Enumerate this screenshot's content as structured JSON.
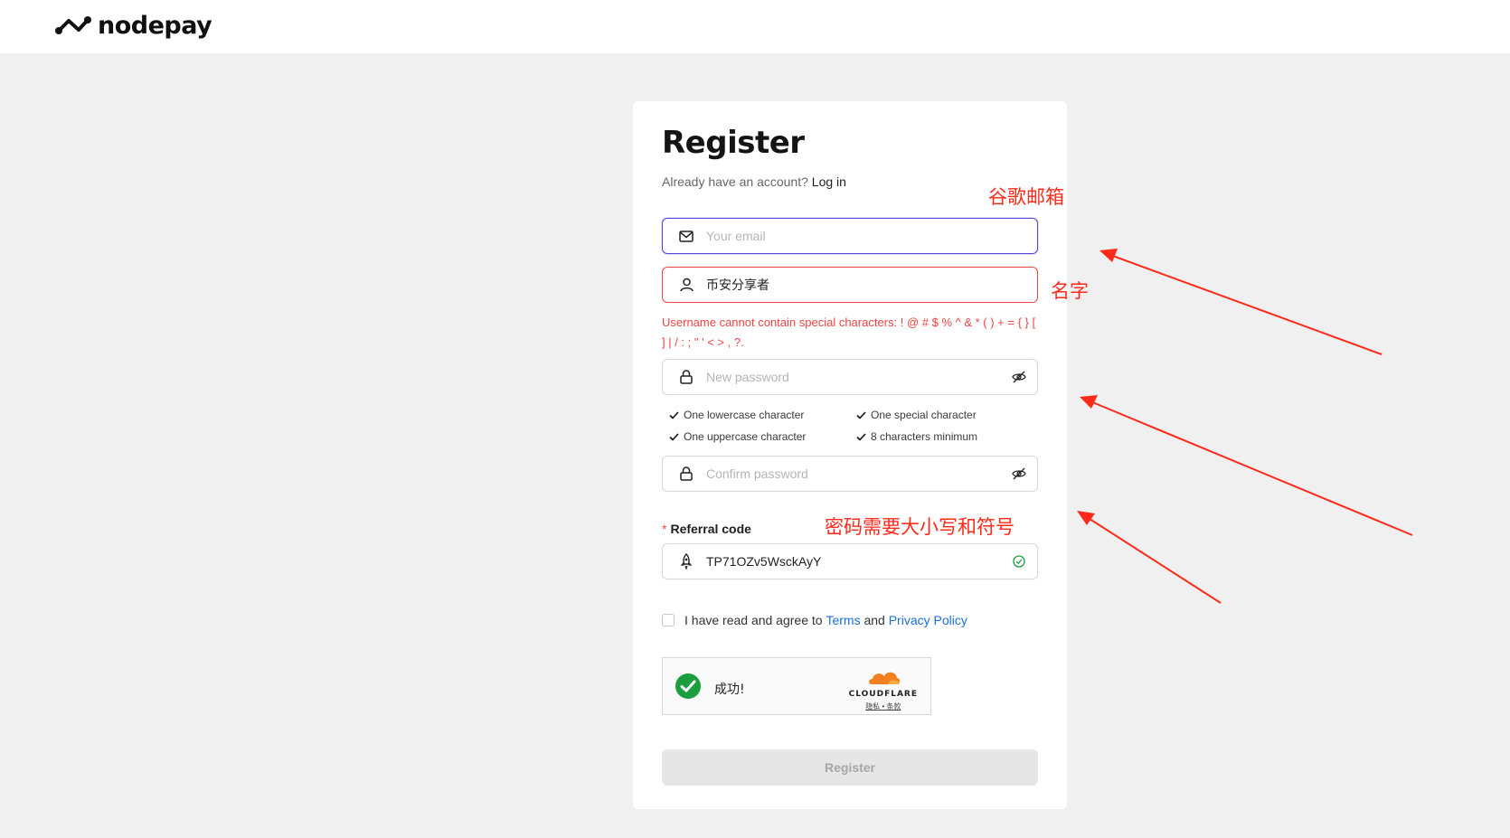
{
  "brand": {
    "name": "nodepay"
  },
  "form": {
    "title": "Register",
    "have_account": "Already have an account?",
    "login_link": "Log in",
    "email_placeholder": "Your email",
    "username_value": "币安分享者",
    "username_error": "Username cannot contain special characters: ! @ # $ % ^ & * ( ) + = { } [ ] | / : ; \" ' < > , ?.",
    "password_placeholder": "New password",
    "requirements": [
      "One lowercase character",
      "One special character",
      "One uppercase character",
      "8 characters minimum"
    ],
    "confirm_placeholder": "Confirm password",
    "referral_label": "Referral code",
    "referral_value": "TP71OZv5WsckAyY",
    "terms_prefix": "I have read and agree to",
    "terms_link": "Terms",
    "terms_and": "and",
    "privacy_link": "Privacy Policy",
    "register_button": "Register"
  },
  "captcha": {
    "status": "成功!",
    "brand": "CLOUDFLARE",
    "links": "隐私 • 条款"
  },
  "annotations": {
    "email_note": "谷歌邮箱",
    "name_note": "名字",
    "password_note": "密码需要大小写和符号"
  },
  "colors": {
    "accent": "#5146d8",
    "error": "#ef4444",
    "link": "#1a6fdb",
    "annotation": "#ff2a1a",
    "success": "#1a9e3f"
  }
}
